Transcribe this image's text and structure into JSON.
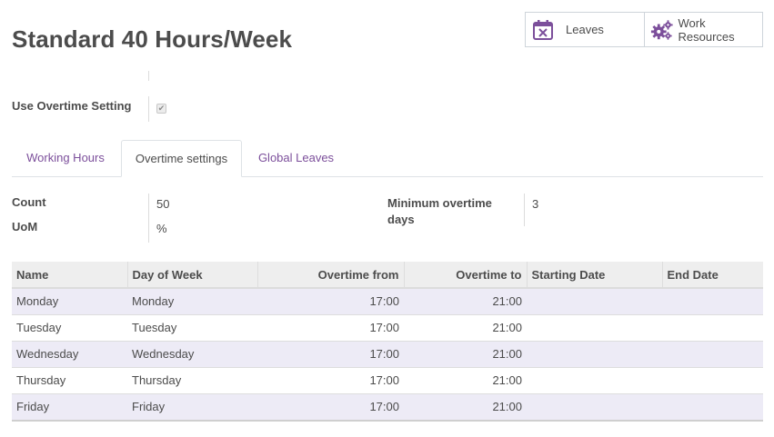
{
  "page": {
    "title": "Standard 40 Hours/Week"
  },
  "smart_buttons": {
    "leaves": {
      "label": "Leaves",
      "icon": "calendar-times-icon"
    },
    "work_resources": {
      "label": "Work\nResources",
      "label_line1": "Work",
      "label_line2": "Resources",
      "icon": "gears-icon"
    }
  },
  "form": {
    "use_overtime_label": "Use Overtime Setting",
    "use_overtime_checked": true
  },
  "tabs": [
    {
      "label": "Working Hours",
      "active": false
    },
    {
      "label": "Overtime settings",
      "active": true
    },
    {
      "label": "Global Leaves",
      "active": false
    }
  ],
  "overtime": {
    "count_label": "Count",
    "count_value": "50",
    "uom_label": "UoM",
    "uom_value": "%",
    "min_days_label_line1": "Minimum overtime",
    "min_days_label_line2": "days",
    "min_days_value": "3"
  },
  "table": {
    "columns": [
      "Name",
      "Day of Week",
      "Overtime from",
      "Overtime to",
      "Starting Date",
      "End Date"
    ],
    "rows": [
      [
        "Monday",
        "Monday",
        "17:00",
        "21:00",
        "",
        ""
      ],
      [
        "Tuesday",
        "Tuesday",
        "17:00",
        "21:00",
        "",
        ""
      ],
      [
        "Wednesday",
        "Wednesday",
        "17:00",
        "21:00",
        "",
        ""
      ],
      [
        "Thursday",
        "Thursday",
        "17:00",
        "21:00",
        "",
        ""
      ],
      [
        "Friday",
        "Friday",
        "17:00",
        "21:00",
        "",
        ""
      ]
    ]
  },
  "colors": {
    "accent": "#7c4f9b",
    "row_stripe": "#edebf6",
    "header_bg": "#eeeeee"
  }
}
